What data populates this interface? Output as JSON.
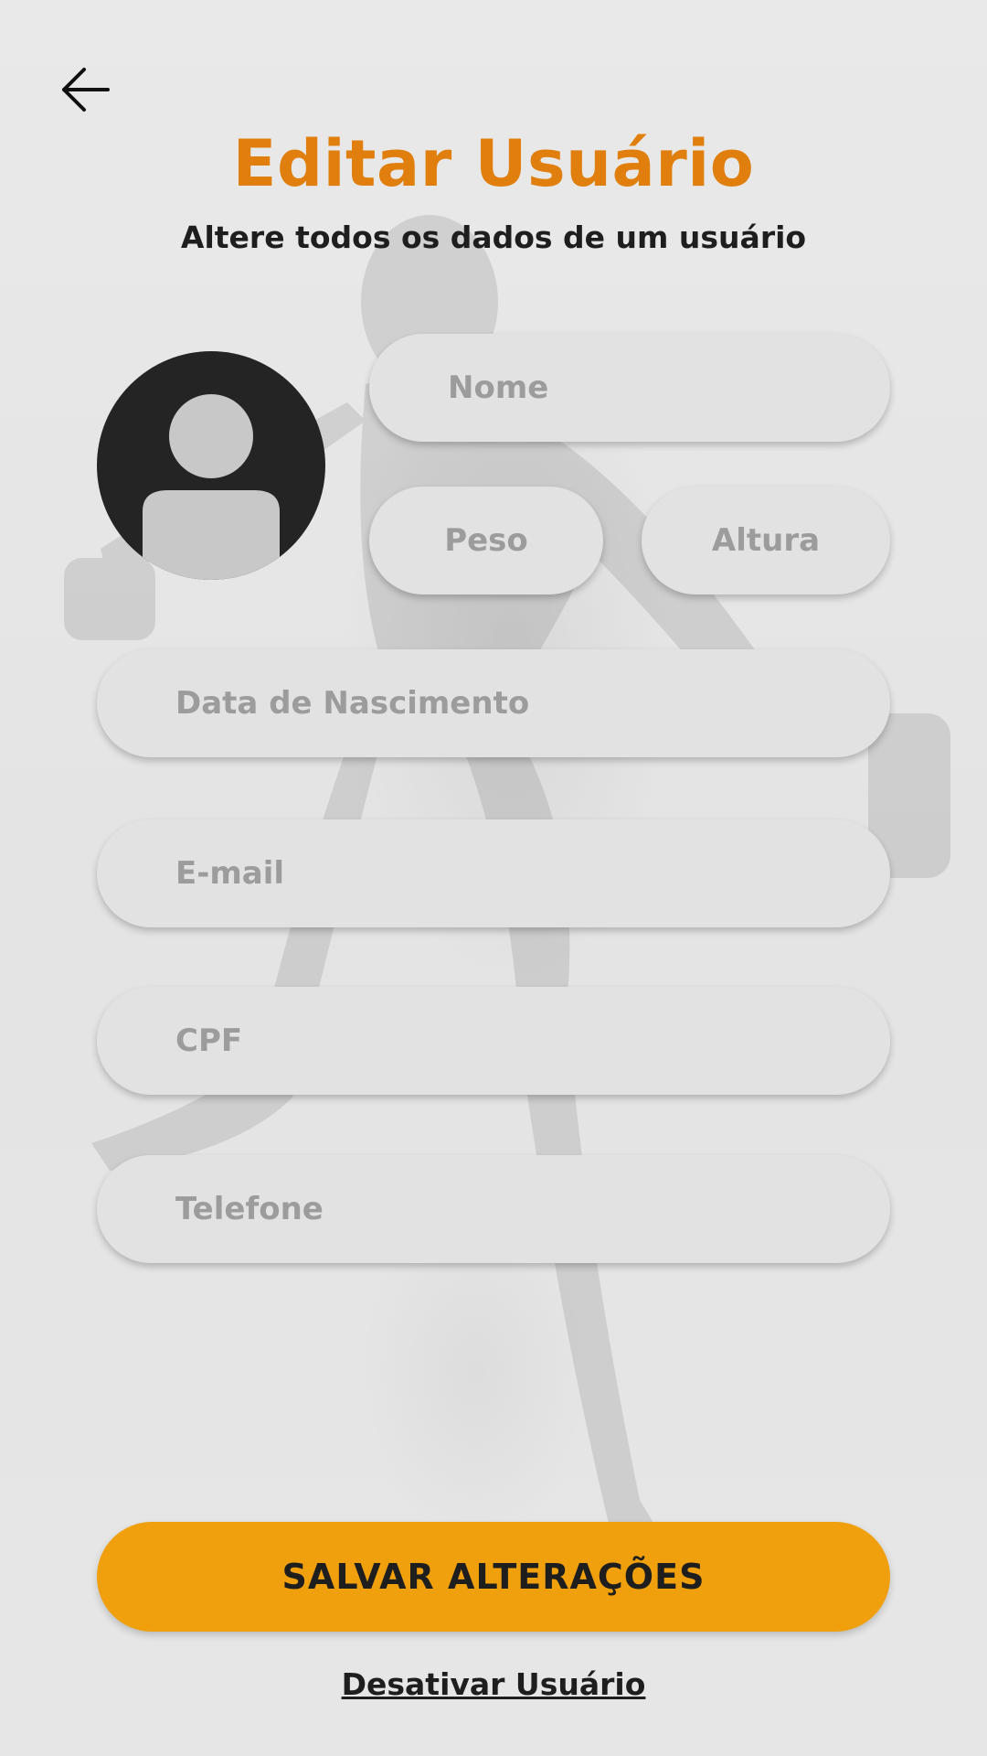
{
  "header": {
    "back_icon": "arrow-left-icon",
    "title": "Editar Usuário",
    "subtitle": "Altere todos os dados de um usuário"
  },
  "avatar": {
    "icon": "user-placeholder-icon"
  },
  "form": {
    "nome_placeholder": "Nome",
    "peso_placeholder": "Peso",
    "altura_placeholder": "Altura",
    "nascimento_placeholder": "Data de Nascimento",
    "email_placeholder": "E-mail",
    "cpf_placeholder": "CPF",
    "telefone_placeholder": "Telefone"
  },
  "actions": {
    "save_label": "SALVAR ALTERAÇÕES",
    "deactivate_label": "Desativar Usuário"
  },
  "colors": {
    "title": "#e07f0e",
    "button": "#f0a00c",
    "field": "#e2e2e2",
    "placeholder": "#9c9c9c"
  }
}
